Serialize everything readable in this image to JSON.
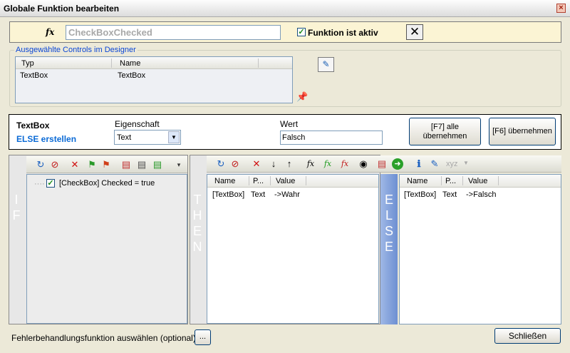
{
  "window": {
    "title": "Globale Funktion bearbeiten",
    "close_glyph": "×"
  },
  "function_bar": {
    "fx_icon": "fx-icon",
    "name_value": "CheckBoxChecked",
    "active_checked": true,
    "active_label": "Funktion ist aktiv",
    "close_glyph": "✕"
  },
  "controls_group": {
    "legend": "Ausgewählte Controls im Designer",
    "columns": [
      "Typ",
      "Name"
    ],
    "rows": [
      {
        "typ": "TextBox",
        "name": "TextBox"
      }
    ]
  },
  "condition": {
    "control_name": "TextBox",
    "else_link": "ELSE erstellen",
    "property_label": "Eigenschaft",
    "property_value": "Text",
    "value_label": "Wert",
    "value_value": "Falsch",
    "btn_all_line1": "[F7] alle",
    "btn_all_line2": "übernehmen",
    "btn_apply": "[F6] übernehmen"
  },
  "if_pane": {
    "letters": [
      "I",
      "F"
    ],
    "tree_item": "[CheckBox] Checked = true"
  },
  "then_pane": {
    "letters": [
      "T",
      "H",
      "E",
      "N"
    ],
    "columns": [
      "Name",
      "P...",
      "Value"
    ],
    "row": {
      "name": "[TextBox]",
      "p": "Text",
      "value": "->Wahr"
    },
    "toolbar_dropdown": "xyz"
  },
  "else_pane": {
    "letters": [
      "E",
      "L",
      "S",
      "E"
    ],
    "columns": [
      "Name",
      "P...",
      "Value"
    ],
    "row": {
      "name": "[TextBox]",
      "p": "Text",
      "value": "->Falsch"
    }
  },
  "footer": {
    "error_label": "Fehlerbehandlungsfunktion auswählen (optional)",
    "browse_label": "...",
    "close_label": "Schließen"
  },
  "colors": {
    "accent_blue": "#0a46d6",
    "vtab_blue": "#7a9bd8",
    "fnbar": "#fbf4d4"
  }
}
